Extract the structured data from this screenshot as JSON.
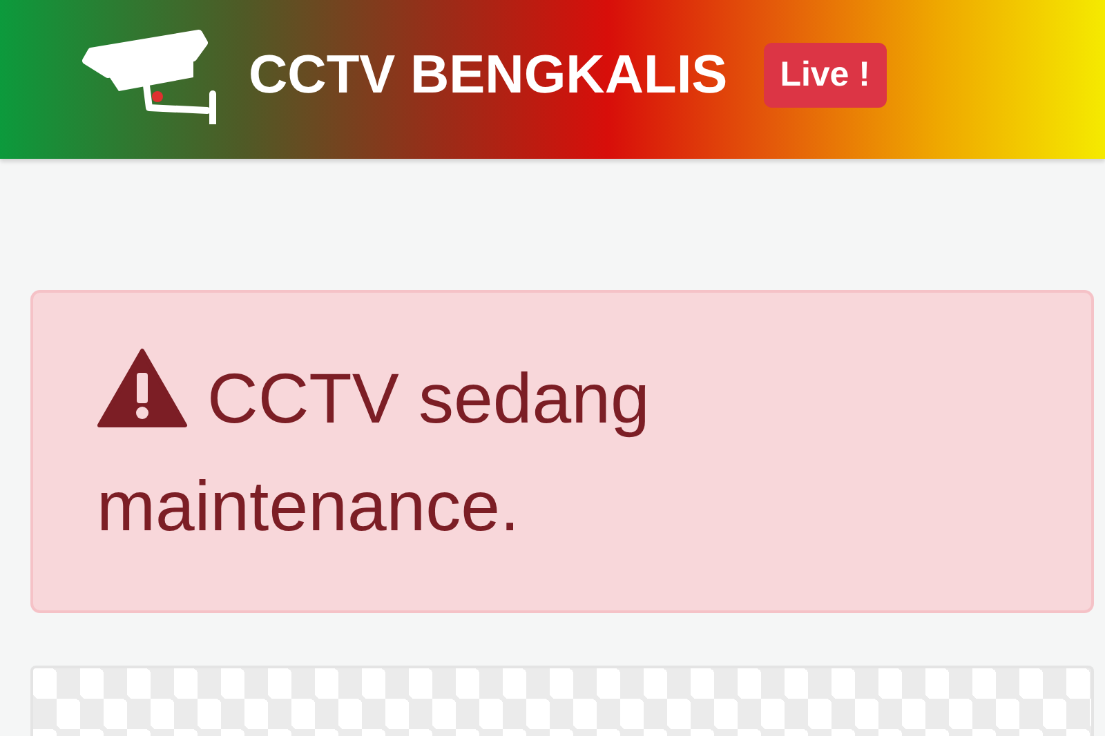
{
  "header": {
    "title": "CCTV BENGKALIS",
    "badge": "Live !"
  },
  "alert": {
    "kind": "warning",
    "message": "CCTV sedang maintenance."
  },
  "stream": {
    "kind": "empty"
  }
}
